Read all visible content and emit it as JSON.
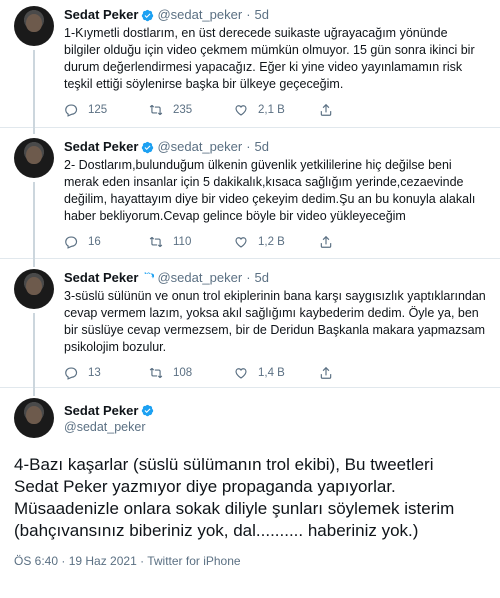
{
  "author": {
    "name": "Sedat Peker",
    "handle": "@sedat_peker"
  },
  "tweets": [
    {
      "time": "5d",
      "text": "1-Kıymetli dostlarım, en üst derecede suikaste uğrayacağım yönünde bilgiler olduğu için video çekmem mümkün olmuyor. 15 gün sonra ikinci bir durum değerlendirmesi yapacağız. Eğer ki yine video yayınlamamın risk teşkil ettiği söylenirse başka bir ülkeye geçeceğim.",
      "replies": "125",
      "retweets": "235",
      "likes": "2,1 B"
    },
    {
      "time": "5d",
      "text": "2- Dostlarım,bulunduğum ülkenin güvenlik yetkililerine hiç değilse beni merak eden insanlar için 5 dakikalık,kısaca sağlığım yerinde,cezaevinde değilim, hayattayım diye bir video çekeyim dedim.Şu an bu konuyla alakalı haber bekliyorum.Cevap gelince böyle bir video yükleyeceğim",
      "replies": "16",
      "retweets": "110",
      "likes": "1,2 B"
    },
    {
      "time": "5d",
      "text": "3-süslü sülünün ve onun trol ekiplerinin bana karşı saygısızlık yaptıklarından cevap vermem lazım, yoksa akıl sağlığımı kaybederim dedim. Öyle ya, ben bir süslüye cevap vermezsem, bir de Deridun Başkanla makara yapmazsam psikolojim bozulur.",
      "replies": "13",
      "retweets": "108",
      "likes": "1,4 B"
    }
  ],
  "main_tweet": {
    "text": "4-Bazı kaşarlar (süslü sülümanın trol ekibi), Bu tweetleri Sedat Peker yazmıyor diye propaganda yapıyorlar. Müsaadenizle onlara sokak diliyle şunları söylemek isterim (bahçıvansınız biberiniz yok, dal.......... haberiniz yok.)",
    "meta": "ÖS 6:40 · 19 Haz 2021 · Twitter for iPhone"
  },
  "colors": {
    "verified": "#1da1f2",
    "muted": "#5b7083",
    "thread_line": "#ccd6dd"
  },
  "icons": [
    "verified-badge-icon",
    "reply-icon",
    "retweet-icon",
    "like-icon",
    "share-icon"
  ]
}
